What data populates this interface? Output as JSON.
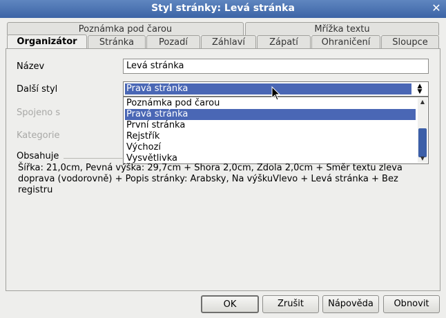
{
  "window": {
    "title": "Styl stránky: Levá stránka",
    "close_glyph": "✕"
  },
  "tabs_row1": [
    "Poznámka pod čarou",
    "Mřížka textu"
  ],
  "tabs_row2": [
    "Organizátor",
    "Stránka",
    "Pozadí",
    "Záhlaví",
    "Zápatí",
    "Ohraničení",
    "Sloupce"
  ],
  "active_tab": "Organizátor",
  "form": {
    "name_label": "Název",
    "name_value": "Levá stránka",
    "next_style_label": "Další styl",
    "next_style_value": "Pravá stránka",
    "linked_label": "Spojeno s",
    "category_label": "Kategorie"
  },
  "dropdown": {
    "items": [
      "Poznámka pod čarou",
      "Pravá stránka",
      "První stránka",
      "Rejstřík",
      "Výchozí",
      "Vysvětlivka"
    ],
    "highlighted": "Pravá stránka"
  },
  "contains": {
    "label": "Obsahuje",
    "text": "Šířka: 21,0cm, Pevná výška: 29,7cm + Shora 2,0cm, Zdola 2,0cm + Směr textu zleva doprava (vodorovně) + Popis stránky: Arabsky, Na výškuVlevo + Levá stránka + Bez registru"
  },
  "buttons": {
    "ok": "OK",
    "cancel": "Zrušit",
    "help": "Nápověda",
    "reset": "Obnovit"
  },
  "colors": {
    "titlebar": "#3c64a6",
    "selection": "#4a67b5"
  },
  "icons": {
    "close": "close-icon",
    "combo_arrow": "updown-arrow-icon",
    "cursor": "mouse-pointer-icon"
  }
}
